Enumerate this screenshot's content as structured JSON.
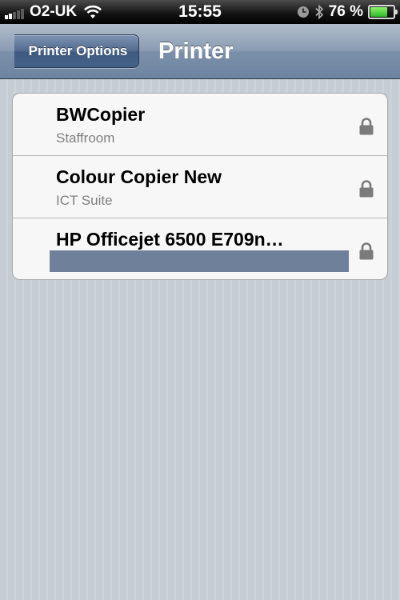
{
  "status_bar": {
    "carrier": "O2-UK",
    "time": "15:55",
    "battery_percent": "76 %",
    "battery_level": 0.76,
    "signal_bars": 2,
    "icons": [
      "signal-icon",
      "wifi-icon",
      "clock-icon",
      "bluetooth-icon",
      "battery-icon"
    ]
  },
  "nav_bar": {
    "back_label": "Printer Options",
    "title": "Printer"
  },
  "printers": [
    {
      "name": "BWCopier",
      "location": "Staffroom",
      "icon": "lock-icon"
    },
    {
      "name": "Colour Copier New",
      "location": "ICT Suite",
      "icon": "lock-icon"
    },
    {
      "name": "HP Officejet 6500 E709n…",
      "location": "",
      "icon": "lock-icon",
      "location_redacted": true
    }
  ],
  "colors": {
    "nav_gradient_top": "#b1bdcb",
    "nav_gradient_bottom": "#6d84a1",
    "background": "#c5ccd4",
    "battery_fill": "#4fd63a"
  }
}
